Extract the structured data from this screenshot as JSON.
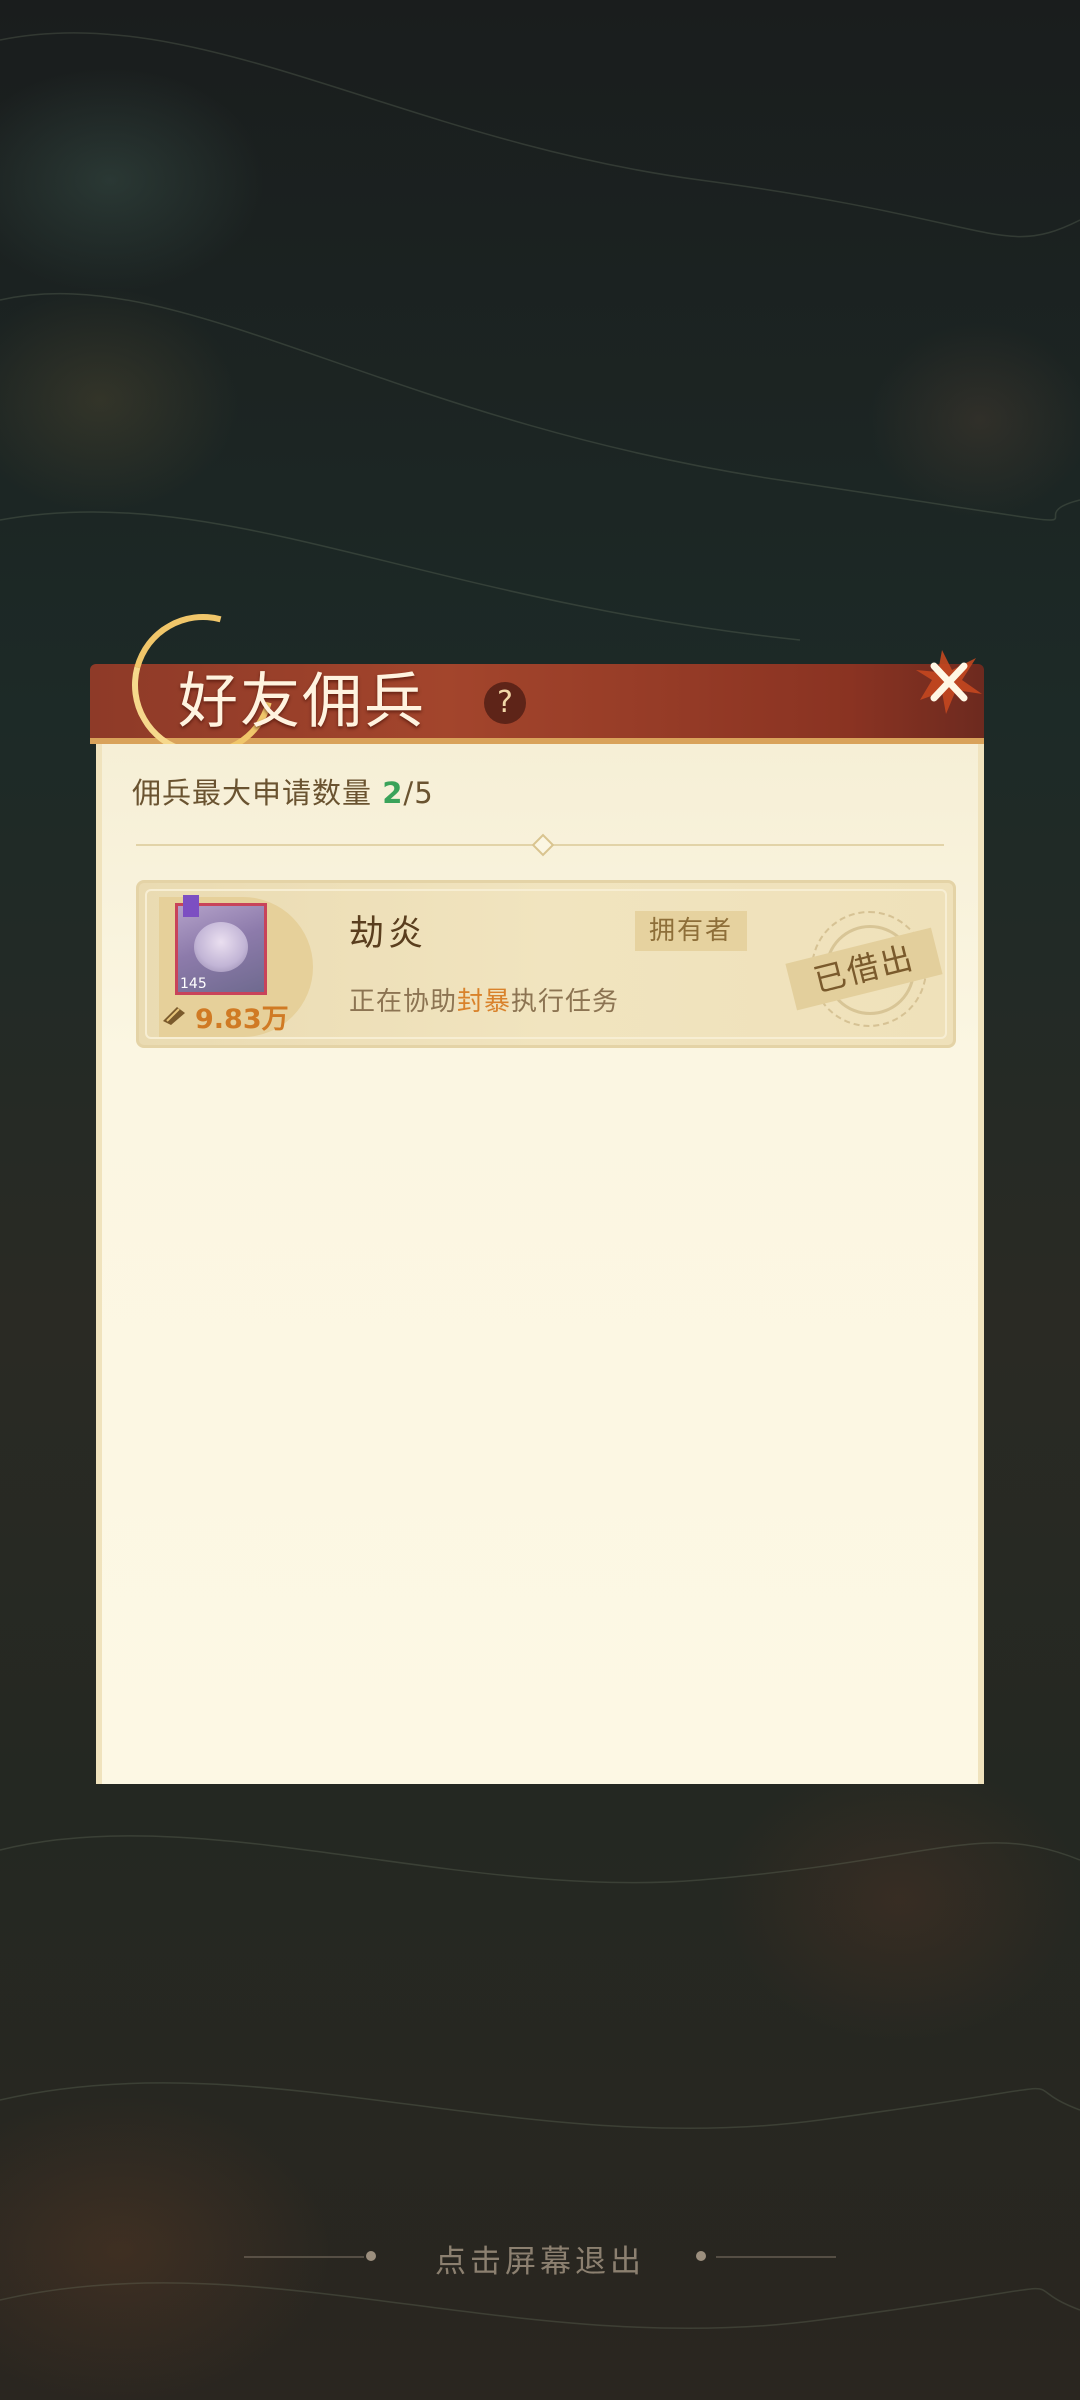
{
  "dialog": {
    "title": "好友佣兵",
    "help_icon": "?",
    "close_icon": "close-icon"
  },
  "capacity": {
    "label": "佣兵最大申请数量",
    "current": "2",
    "separator": "/",
    "max": "5"
  },
  "mercenaries": [
    {
      "name": "劫炎",
      "owner_tag": "拥有者",
      "level": "145",
      "power": "9.83万",
      "status_prefix": "正在协助",
      "helping_player": "封暴",
      "status_suffix": "执行任务",
      "stamp": "已借出"
    }
  ],
  "footer": {
    "exit_hint": "点击屏幕退出"
  },
  "colors": {
    "title_bar": "#a3452c",
    "panel": "#fbf6e2",
    "capacity_current": "#3aa35a",
    "highlight": "#d9822b"
  }
}
